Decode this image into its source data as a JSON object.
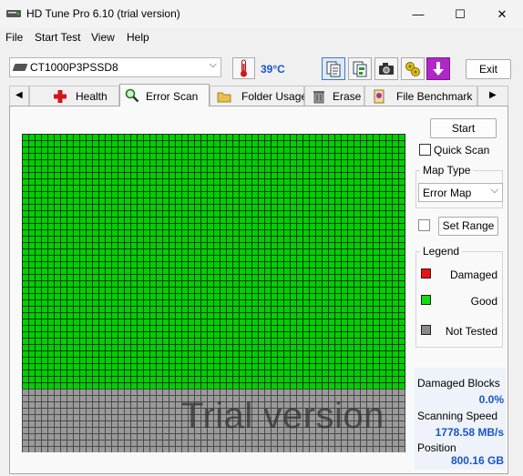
{
  "window": {
    "title": "HD Tune Pro 6.10 (trial version)",
    "minimize_glyph": "—",
    "maximize_glyph": "☐",
    "close_glyph": "✕"
  },
  "menu": {
    "items": [
      "File",
      "Start Test",
      "View",
      "Help"
    ]
  },
  "toolbar": {
    "drive": "CT1000P3PSSD8",
    "temperature": "39°C",
    "temp_color": "#1a55c8",
    "tools": [
      {
        "icon": "copy-info-icon"
      },
      {
        "icon": "copy-results-icon"
      },
      {
        "icon": "screenshot-camera-icon"
      },
      {
        "icon": "options-icon"
      },
      {
        "icon": "save-download-icon"
      }
    ],
    "exit_label": "Exit"
  },
  "tabs": {
    "items": [
      "Health",
      "Error Scan",
      "Folder Usage",
      "Erase",
      "File Benchmark"
    ],
    "active": "Error Scan",
    "left_arrow": "◀",
    "right_arrow": "▶"
  },
  "scan": {
    "start_label": "Start",
    "quick_scan_label": "Quick Scan",
    "quick_scan_checked": false,
    "map_type_title": "Map Type",
    "map_type_value": "Error Map",
    "set_range_label": "Set Range",
    "set_range_checked": false,
    "legend_title": "Legend",
    "legend": [
      {
        "label": "Damaged",
        "color": "#ee1111"
      },
      {
        "label": "Good",
        "color": "#11dd11"
      },
      {
        "label": "Not Tested",
        "color": "#8a8a8a"
      }
    ],
    "watermark": "Trial version",
    "good_color": "#00d000",
    "not_tested_color": "#9a9a9a",
    "scanned_fraction": 0.8
  },
  "stats": {
    "damaged_blocks_label": "Damaged Blocks",
    "damaged_blocks_value": "0.0%",
    "scanning_speed_label": "Scanning Speed",
    "scanning_speed_value": "1778.58 MB/s",
    "position_label": "Position",
    "position_value": "800.16 GB",
    "value_color": "#1a55c8"
  }
}
